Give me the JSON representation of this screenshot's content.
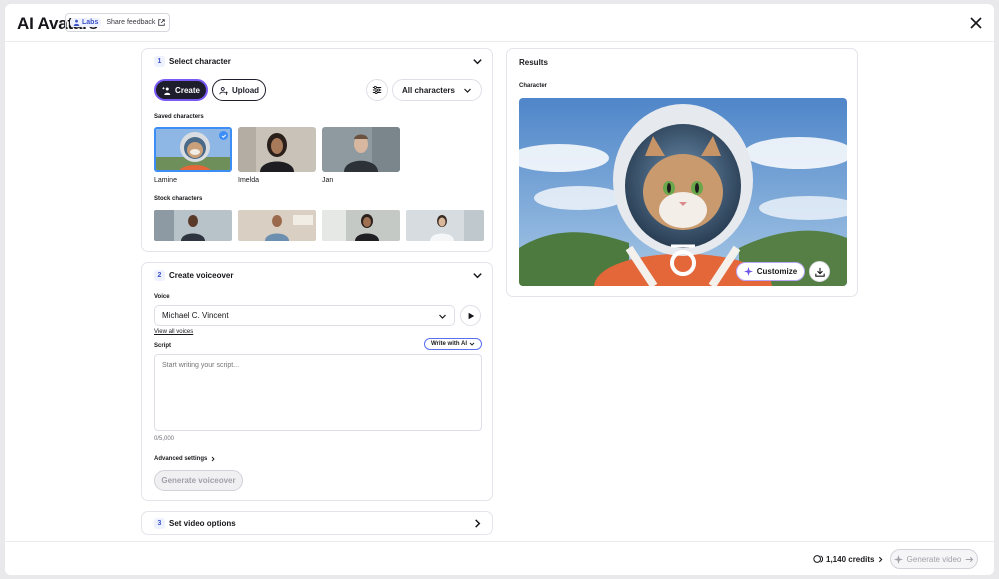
{
  "header": {
    "app_title": "AI Avatars",
    "labs_badge": "Labs",
    "feedback_label": "Share feedback"
  },
  "step1": {
    "number": "1",
    "title": "Select character",
    "create_label": "Create",
    "upload_label": "Upload",
    "filter_label": "All characters",
    "saved_label": "Saved characters",
    "saved": [
      {
        "name": "Lamine",
        "selected": true
      },
      {
        "name": "Imelda",
        "selected": false
      },
      {
        "name": "Jan",
        "selected": false
      }
    ],
    "stock_label": "Stock characters"
  },
  "step2": {
    "number": "2",
    "title": "Create voiceover",
    "voice_label": "Voice",
    "voice_value": "Michael C. Vincent",
    "view_all_voices": "View all voices",
    "script_label": "Script",
    "write_ai_label": "Write with AI",
    "script_placeholder": "Start writing your script...",
    "char_count": "0/5,000",
    "advanced_label": "Advanced settings",
    "generate_label": "Generate voiceover"
  },
  "step3": {
    "number": "3",
    "title": "Set video options"
  },
  "results": {
    "title": "Results",
    "character_label": "Character",
    "customize_label": "Customize"
  },
  "footer": {
    "credits": "1,140 credits",
    "generate_video_label": "Generate video"
  },
  "colors": {
    "accent": "#3c51c8",
    "selection": "#3c8ef6",
    "create_border": "#7a5af5"
  }
}
